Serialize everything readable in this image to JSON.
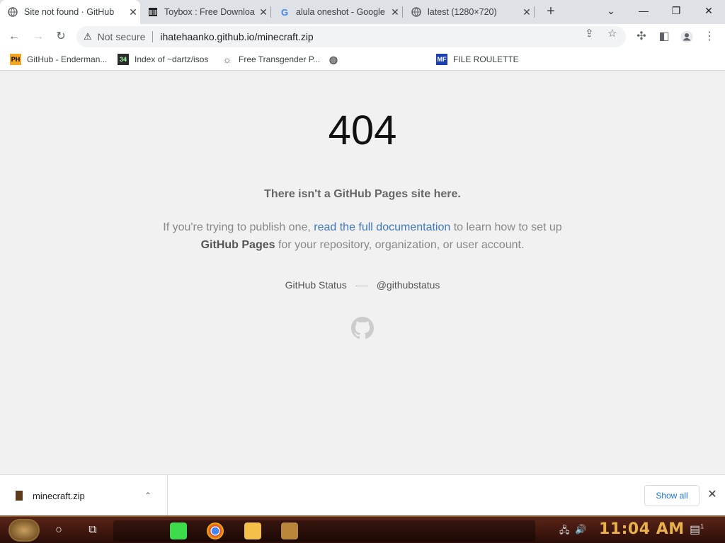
{
  "tabs": [
    {
      "title": "Site not found · GitHub",
      "icon": "globe-icon",
      "active": true
    },
    {
      "title": "Toybox : Free Downloa",
      "icon": "archive-icon",
      "active": false
    },
    {
      "title": "alula oneshot - Google",
      "icon": "google-icon",
      "active": false
    },
    {
      "title": "latest (1280×720)",
      "icon": "globe-icon",
      "active": false
    }
  ],
  "window_controls": {
    "dropdown": "⌄",
    "minimize": "—",
    "restore": "❐",
    "close": "✕"
  },
  "toolbar": {
    "security_label": "Not secure",
    "url": "ihatehaanko.github.io/minecraft.zip"
  },
  "bookmarks": [
    {
      "label": "GitHub - Enderman...",
      "icon": "PH",
      "color": "#f5a623"
    },
    {
      "label": "Index of ~dartz/isos",
      "icon": "34",
      "color": "#2b2b2b"
    },
    {
      "label": "Free Transgender P...",
      "icon": "☼",
      "color": "#555555"
    },
    {
      "label": "",
      "icon": "◍",
      "color": "#555555"
    },
    {
      "label": "FILE ROULETTE",
      "icon": "MF",
      "color": "#1b3fb0"
    }
  ],
  "page": {
    "code": "404",
    "lead": "There isn't a GitHub Pages site here.",
    "para_before": "If you're trying to publish one, ",
    "para_link": "read the full documentation",
    "para_mid": " to learn how to set up",
    "para_bold": "GitHub Pages",
    "para_after": " for your repository, organization, or user account.",
    "footer_status": "GitHub Status",
    "footer_handle": "@githubstatus"
  },
  "downloads": {
    "filename": "minecraft.zip",
    "show_all_label": "Show all"
  },
  "taskbar": {
    "time": "11:04 AM",
    "notification_count": "1"
  },
  "colors": {
    "link": "#4078c0",
    "clock": "#e8b14a"
  }
}
